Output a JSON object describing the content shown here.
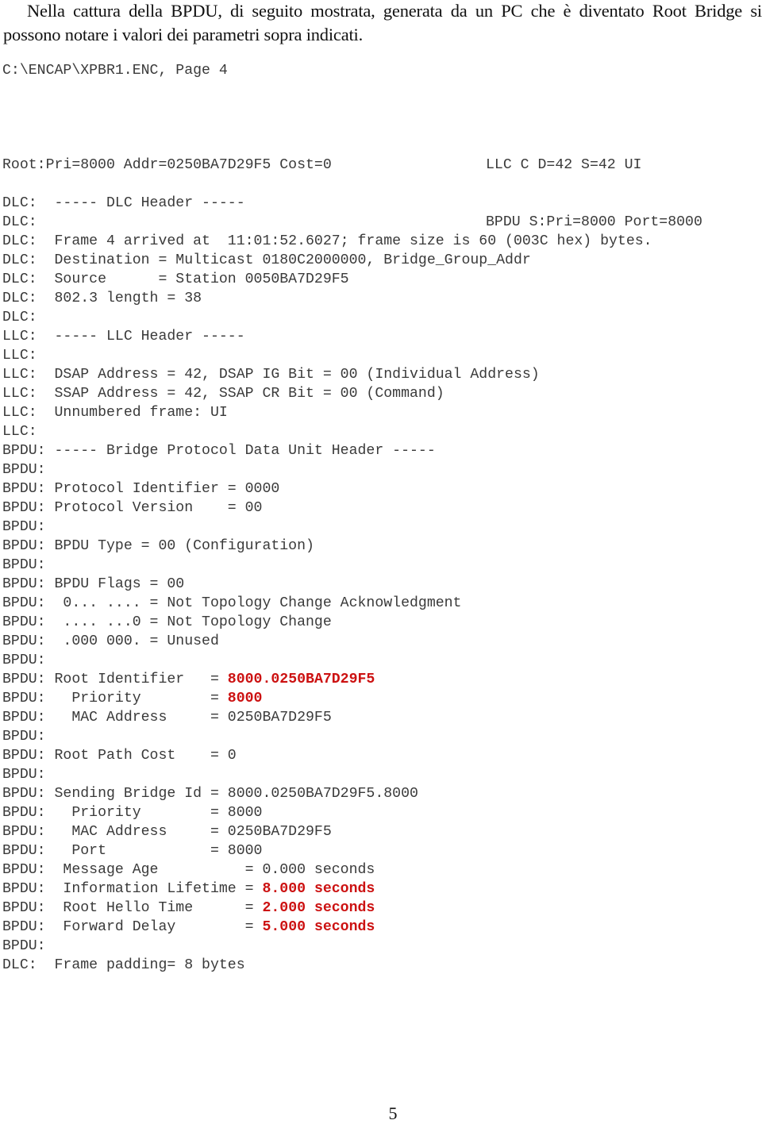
{
  "intro_paragraph": "Nella cattura della BPDU, di seguito mostrata, generata da un PC che è diventato Root Bridge si possono notare i valori dei parametri sopra indicati.",
  "capture_title": "C:\\ENCAP\\XPBR1.ENC, Page 4",
  "summary": {
    "llc_line": "LLC C D=42 S=42 UI",
    "bpdu_line": "BPDU S:Pri=8000 Port=8000",
    "root_line": "Root:Pri=8000 Addr=0250BA7D29F5 Cost=0"
  },
  "highlight_color": "#cc1111",
  "decode_lines": [
    {
      "prefix": "DLC:  ",
      "text": "----- DLC Header -----"
    },
    {
      "prefix": "DLC:  ",
      "text": ""
    },
    {
      "prefix": "DLC:  ",
      "text": "Frame 4 arrived at  11:01:52.6027; frame size is 60 (003C hex) bytes."
    },
    {
      "prefix": "DLC:  ",
      "text": "Destination = Multicast 0180C2000000, Bridge_Group_Addr"
    },
    {
      "prefix": "DLC:  ",
      "text": "Source      = Station 0050BA7D29F5"
    },
    {
      "prefix": "DLC:  ",
      "text": "802.3 length = 38"
    },
    {
      "prefix": "DLC:  ",
      "text": ""
    },
    {
      "prefix": "LLC:  ",
      "text": "----- LLC Header -----"
    },
    {
      "prefix": "LLC:  ",
      "text": ""
    },
    {
      "prefix": "LLC:  ",
      "text": "DSAP Address = 42, DSAP IG Bit = 00 (Individual Address)"
    },
    {
      "prefix": "LLC:  ",
      "text": "SSAP Address = 42, SSAP CR Bit = 00 (Command)"
    },
    {
      "prefix": "LLC:  ",
      "text": "Unnumbered frame: UI"
    },
    {
      "prefix": "LLC:  ",
      "text": ""
    },
    {
      "prefix": "BPDU: ",
      "text": "----- Bridge Protocol Data Unit Header -----"
    },
    {
      "prefix": "BPDU: ",
      "text": ""
    },
    {
      "prefix": "BPDU: ",
      "text": "Protocol Identifier = 0000"
    },
    {
      "prefix": "BPDU: ",
      "text": "Protocol Version    = 00"
    },
    {
      "prefix": "BPDU: ",
      "text": ""
    },
    {
      "prefix": "BPDU: ",
      "text": "BPDU Type = 00 (Configuration)"
    },
    {
      "prefix": "BPDU: ",
      "text": ""
    },
    {
      "prefix": "BPDU: ",
      "text": "BPDU Flags = 00"
    },
    {
      "prefix": "BPDU: ",
      "text": " 0... .... = Not Topology Change Acknowledgment"
    },
    {
      "prefix": "BPDU: ",
      "text": " .... ...0 = Not Topology Change"
    },
    {
      "prefix": "BPDU: ",
      "text": " .000 000. = Unused"
    },
    {
      "prefix": "BPDU: ",
      "text": ""
    },
    {
      "prefix": "BPDU: ",
      "text": "Root Identifier   = ",
      "value": "8000.0250BA7D29F5",
      "highlight": true
    },
    {
      "prefix": "BPDU: ",
      "text": "  Priority        = ",
      "value": "8000",
      "highlight": true
    },
    {
      "prefix": "BPDU: ",
      "text": "  MAC Address     = 0250BA7D29F5"
    },
    {
      "prefix": "BPDU: ",
      "text": ""
    },
    {
      "prefix": "BPDU: ",
      "text": "Root Path Cost    = 0"
    },
    {
      "prefix": "BPDU: ",
      "text": ""
    },
    {
      "prefix": "BPDU: ",
      "text": "Sending Bridge Id = 8000.0250BA7D29F5.8000"
    },
    {
      "prefix": "BPDU: ",
      "text": "  Priority        = 8000"
    },
    {
      "prefix": "BPDU: ",
      "text": "  MAC Address     = 0250BA7D29F5"
    },
    {
      "prefix": "BPDU: ",
      "text": "  Port            = 8000"
    },
    {
      "prefix": "BPDU: ",
      "text": " Message Age          = 0.000 seconds"
    },
    {
      "prefix": "BPDU: ",
      "text": " Information Lifetime = ",
      "value": "8.000 seconds",
      "highlight": true
    },
    {
      "prefix": "BPDU: ",
      "text": " Root Hello Time      = ",
      "value": "2.000 seconds",
      "highlight": true
    },
    {
      "prefix": "BPDU: ",
      "text": " Forward Delay        = ",
      "value": "5.000 seconds",
      "highlight": true
    },
    {
      "prefix": "BPDU: ",
      "text": ""
    },
    {
      "prefix": "DLC:  ",
      "text": "Frame padding= 8 bytes"
    }
  ],
  "page_number": "5"
}
